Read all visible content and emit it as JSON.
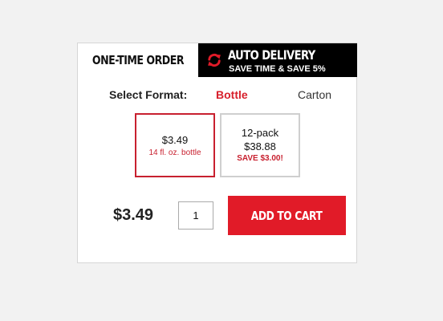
{
  "tabs": {
    "one_time": "ONE-TIME ORDER",
    "auto_delivery": {
      "title": "AUTO DELIVERY",
      "subtitle": "SAVE TIME & SAVE 5%",
      "icon": "refresh-icon"
    }
  },
  "format": {
    "label": "Select Format:",
    "options": [
      "Bottle",
      "Carton"
    ],
    "selected": "Bottle"
  },
  "sizes": [
    {
      "price": "$3.49",
      "description": "14 fl. oz. bottle",
      "selected": true
    },
    {
      "name": "12-pack",
      "price": "$38.88",
      "savings": "SAVE $3.00!",
      "selected": false
    }
  ],
  "price": "$3.49",
  "quantity": "1",
  "add_to_cart": "ADD TO CART",
  "colors": {
    "accent": "#e11b28",
    "tab_dark": "#000000",
    "background": "#f2f2f2"
  }
}
